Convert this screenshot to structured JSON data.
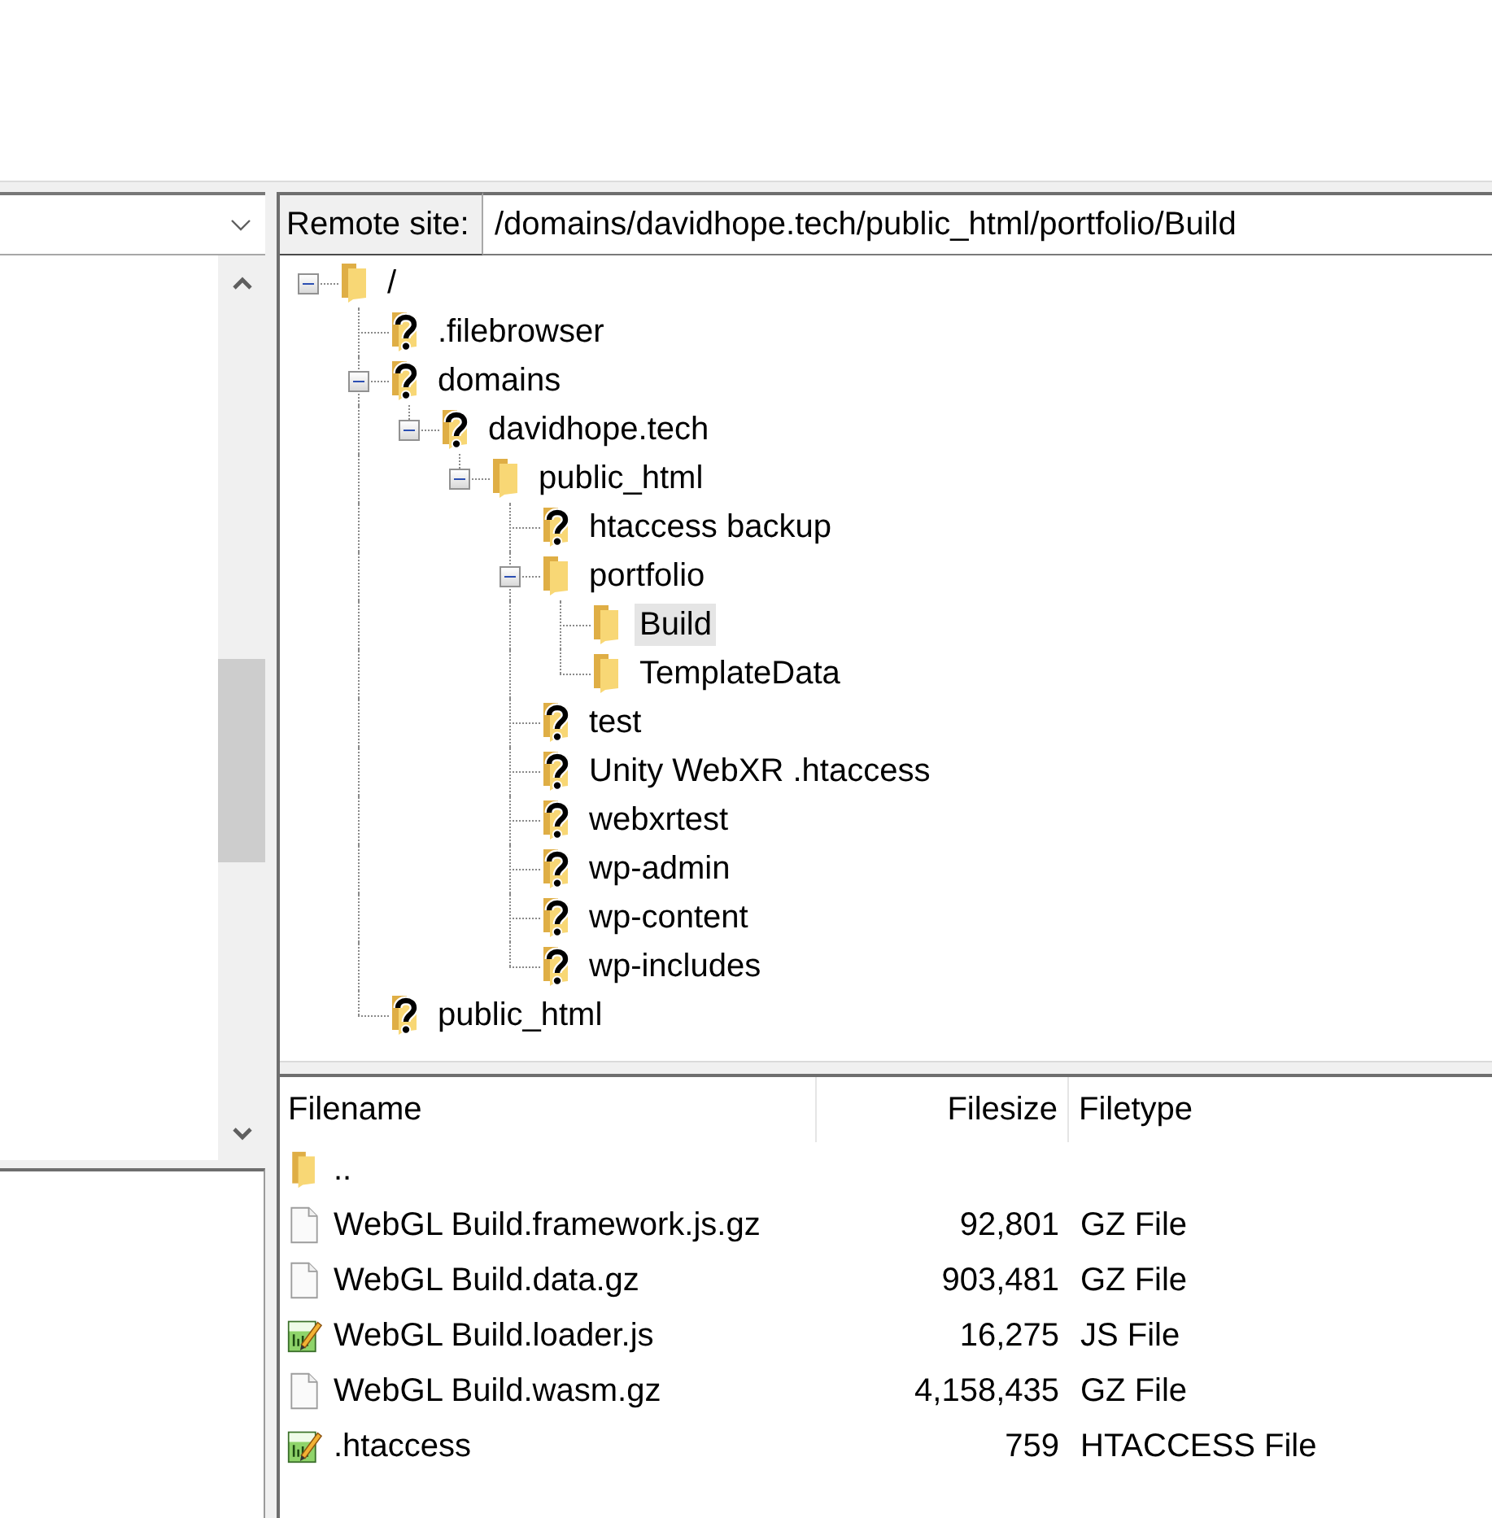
{
  "remote_site": {
    "label": "Remote site:",
    "path": "/domains/davidhope.tech/public_html/portfolio/Build"
  },
  "remote_tree": [
    {
      "label": "/",
      "kind": "folder",
      "expanded": true,
      "selected": false,
      "children": [
        {
          "label": ".filebrowser",
          "kind": "unknown",
          "selected": false
        },
        {
          "label": "domains",
          "kind": "unknown",
          "expanded": true,
          "selected": false,
          "children": [
            {
              "label": "davidhope.tech",
              "kind": "unknown",
              "expanded": true,
              "selected": false,
              "children": [
                {
                  "label": "public_html",
                  "kind": "folder",
                  "expanded": true,
                  "selected": false,
                  "children": [
                    {
                      "label": "htaccess backup",
                      "kind": "unknown",
                      "selected": false
                    },
                    {
                      "label": "portfolio",
                      "kind": "folder",
                      "expanded": true,
                      "selected": false,
                      "children": [
                        {
                          "label": "Build",
                          "kind": "folder",
                          "selected": true
                        },
                        {
                          "label": "TemplateData",
                          "kind": "folder",
                          "selected": false
                        }
                      ]
                    },
                    {
                      "label": "test",
                      "kind": "unknown",
                      "selected": false
                    },
                    {
                      "label": "Unity WebXR .htaccess",
                      "kind": "unknown",
                      "selected": false
                    },
                    {
                      "label": "webxrtest",
                      "kind": "unknown",
                      "selected": false
                    },
                    {
                      "label": "wp-admin",
                      "kind": "unknown",
                      "selected": false
                    },
                    {
                      "label": "wp-content",
                      "kind": "unknown",
                      "selected": false
                    },
                    {
                      "label": "wp-includes",
                      "kind": "unknown",
                      "selected": false
                    }
                  ]
                }
              ]
            }
          ]
        },
        {
          "label": "public_html",
          "kind": "unknown",
          "selected": false
        }
      ]
    }
  ],
  "file_list": {
    "columns": [
      "Filename",
      "Filesize",
      "Filetype"
    ],
    "rows": [
      {
        "kind": "folder",
        "name": ".."
      },
      {
        "kind": "file",
        "name": "WebGL Build.framework.js.gz",
        "size": "92,801",
        "type": "GZ File"
      },
      {
        "kind": "file",
        "name": "WebGL Build.data.gz",
        "size": "903,481",
        "type": "GZ File"
      },
      {
        "kind": "script",
        "name": "WebGL Build.loader.js",
        "size": "16,275",
        "type": "JS File"
      },
      {
        "kind": "file",
        "name": "WebGL Build.wasm.gz",
        "size": "4,158,435",
        "type": "GZ File"
      },
      {
        "kind": "script",
        "name": ".htaccess",
        "size": "759",
        "type": "HTACCESS File"
      }
    ]
  }
}
